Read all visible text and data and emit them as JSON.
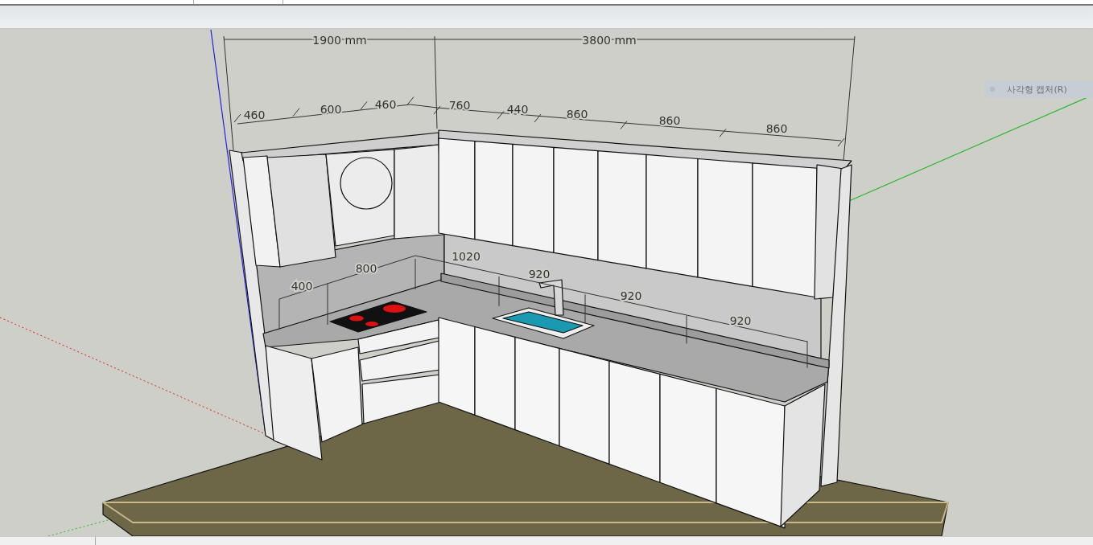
{
  "overall_dimensions": [
    "1900 mm",
    "3800 mm"
  ],
  "upper_dimensions": [
    "460",
    "600",
    "460",
    "760",
    "440",
    "860",
    "860",
    "860"
  ],
  "counter_dimensions": [
    "400",
    "800",
    "1020",
    "920",
    "920",
    "920"
  ],
  "capture_button": {
    "label": "사각형 캡처(R)"
  }
}
